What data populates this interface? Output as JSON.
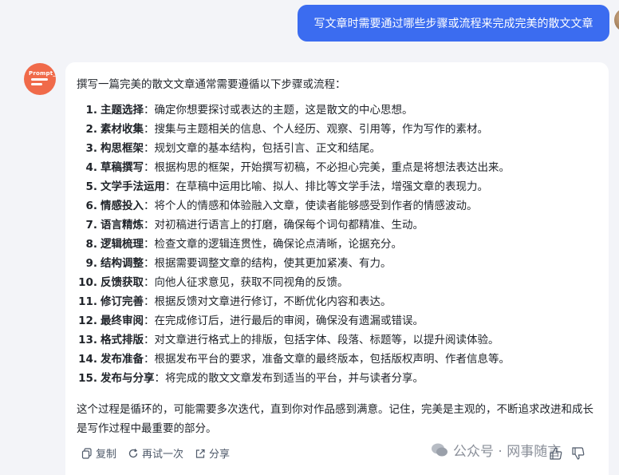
{
  "user_message": "写文章时需要通过哪些步骤或流程来完成完美的散文文章",
  "bot": {
    "avatar_brand": "Prompt_",
    "intro": "撰写一篇完美的散文文章通常需要遵循以下步骤或流程：",
    "steps": [
      {
        "num": "1.",
        "title": "主题选择",
        "desc": "：确定你想要探讨或表达的主题，这是散文的中心思想。"
      },
      {
        "num": "2.",
        "title": "素材收集",
        "desc": "：搜集与主题相关的信息、个人经历、观察、引用等，作为写作的素材。"
      },
      {
        "num": "3.",
        "title": "构思框架",
        "desc": "：规划文章的基本结构，包括引言、正文和结尾。"
      },
      {
        "num": "4.",
        "title": "草稿撰写",
        "desc": "：根据构思的框架，开始撰写初稿，不必担心完美，重点是将想法表达出来。"
      },
      {
        "num": "5.",
        "title": "文学手法运用",
        "desc": "：在草稿中运用比喻、拟人、排比等文学手法，增强文章的表现力。"
      },
      {
        "num": "6.",
        "title": "情感投入",
        "desc": "：将个人的情感和体验融入文章，使读者能够感受到作者的情感波动。"
      },
      {
        "num": "7.",
        "title": "语言精炼",
        "desc": "：对初稿进行语言上的打磨，确保每个词句都精准、生动。"
      },
      {
        "num": "8.",
        "title": "逻辑梳理",
        "desc": "：检查文章的逻辑连贯性，确保论点清晰，论据充分。"
      },
      {
        "num": "9.",
        "title": "结构调整",
        "desc": "：根据需要调整文章的结构，使其更加紧凑、有力。"
      },
      {
        "num": "10.",
        "title": "反馈获取",
        "desc": "：向他人征求意见，获取不同视角的反馈。"
      },
      {
        "num": "11.",
        "title": "修订完善",
        "desc": "：根据反馈对文章进行修订，不断优化内容和表达。"
      },
      {
        "num": "12.",
        "title": "最终审阅",
        "desc": "：在完成修订后，进行最后的审阅，确保没有遗漏或错误。"
      },
      {
        "num": "13.",
        "title": "格式排版",
        "desc": "：对文章进行格式上的排版，包括字体、段落、标题等，以提升阅读体验。"
      },
      {
        "num": "14.",
        "title": "发布准备",
        "desc": "：根据发布平台的要求，准备文章的最终版本，包括版权声明、作者信息等。"
      },
      {
        "num": "15.",
        "title": "发布与分享",
        "desc": "：将完成的散文文章发布到适当的平台，并与读者分享。"
      }
    ],
    "summary": "这个过程是循环的，可能需要多次迭代，直到你对作品感到满意。记住，完美是主观的，不断追求改进和成长是写作过程中最重要的部分。"
  },
  "actions": {
    "copy": "复制",
    "retry": "再试一次",
    "share": "分享"
  },
  "watermark": "公众号 · 网事随言",
  "colors": {
    "user_bubble": "#3b6cf0",
    "bot_avatar": "#f06a4a",
    "background": "#f3f4f8",
    "card": "#ffffff"
  }
}
